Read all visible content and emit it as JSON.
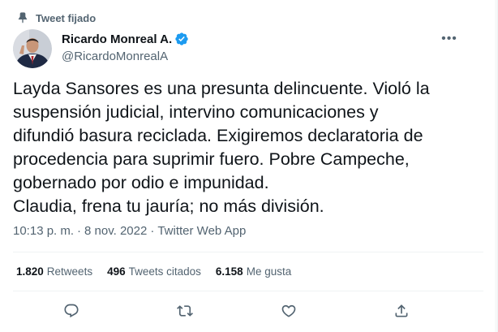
{
  "pinned": {
    "label": "Tweet fijado"
  },
  "author": {
    "display_name": "Ricardo Monreal A.",
    "handle": "@RicardoMonrealA",
    "verified": true
  },
  "tweet": {
    "lines": [
      "Layda Sansores es una presunta delincuente. Violó la",
      "suspensión judicial, intervino comunicaciones y",
      "difundió basura reciclada. Exigiremos declaratoria de",
      "procedencia para suprimir fuero. Pobre Campeche,",
      "gobernado por odio e impunidad.",
      "Claudia, frena tu jauría; no más división."
    ]
  },
  "meta": {
    "time": "10:13 p. m.",
    "separator": "·",
    "date": "8 nov. 2022",
    "source": "Twitter Web App"
  },
  "stats": {
    "retweets": {
      "count": "1.820",
      "label": "Retweets"
    },
    "quotes": {
      "count": "496",
      "label": "Tweets citados"
    },
    "likes": {
      "count": "6.158",
      "label": "Me gusta"
    }
  },
  "actions": [
    "reply-icon",
    "retweet-icon",
    "like-icon",
    "share-icon"
  ],
  "colors": {
    "text": "#0f1419",
    "secondary": "#536471",
    "divider": "#eff3f4",
    "verified": "#1d9bf0"
  }
}
